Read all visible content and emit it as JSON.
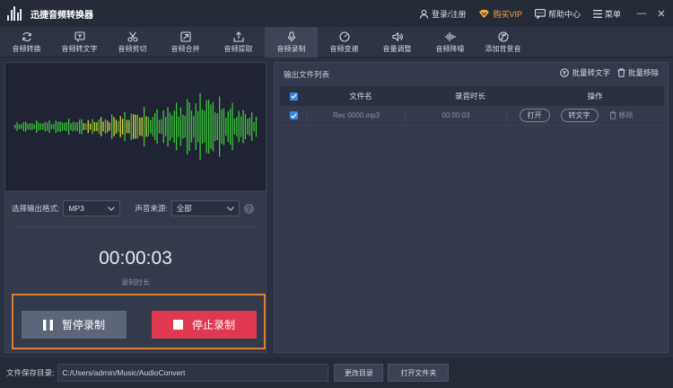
{
  "app": {
    "title": "迅捷音频转换器"
  },
  "header_links": {
    "login": "登录/注册",
    "vip": "购买VIP",
    "help": "帮助中心",
    "menu": "菜单"
  },
  "toolbar": {
    "items": [
      {
        "label": "音频转换",
        "icon": "refresh-icon"
      },
      {
        "label": "音频转文字",
        "icon": "voice-text-icon"
      },
      {
        "label": "音频剪切",
        "icon": "scissors-icon"
      },
      {
        "label": "音频合并",
        "icon": "merge-icon"
      },
      {
        "label": "音频提取",
        "icon": "extract-icon"
      },
      {
        "label": "音频录制",
        "icon": "microphone-icon",
        "active": true
      },
      {
        "label": "音频变速",
        "icon": "speed-icon"
      },
      {
        "label": "音量调整",
        "icon": "volume-icon"
      },
      {
        "label": "音频降噪",
        "icon": "denoise-icon"
      },
      {
        "label": "添加背景音",
        "icon": "music-icon"
      }
    ]
  },
  "recorder": {
    "format_label": "选择输出格式:",
    "format_value": "MP3",
    "source_label": "声音来源:",
    "source_value": "全部",
    "timer": "00:00:03",
    "timer_label": "录制时长",
    "pause_label": "暂停录制",
    "stop_label": "停止录制"
  },
  "output": {
    "title": "输出文件列表",
    "batch_text": "批量转文字",
    "batch_remove": "批量移除",
    "columns": {
      "name": "文件名",
      "duration": "录音时长",
      "ops": "操作"
    },
    "rows": [
      {
        "name": "Rec 0000.mp3",
        "duration": "00:00:03",
        "open": "打开",
        "to_text": "转文字",
        "remove": "移除"
      }
    ]
  },
  "footer": {
    "save_label": "文件保存目录:",
    "path": "C:/Users/admin/Music/AudioConvert",
    "change_dir": "更改目录",
    "open_folder": "打开文件夹"
  },
  "colors": {
    "accent_blue": "#3a86e8",
    "stop_red": "#e0384e",
    "highlight_orange": "#e07d2e",
    "vip_orange": "#f2a63a",
    "wave_green": "#3ac43a",
    "wave_yellow": "#d8d23a"
  }
}
